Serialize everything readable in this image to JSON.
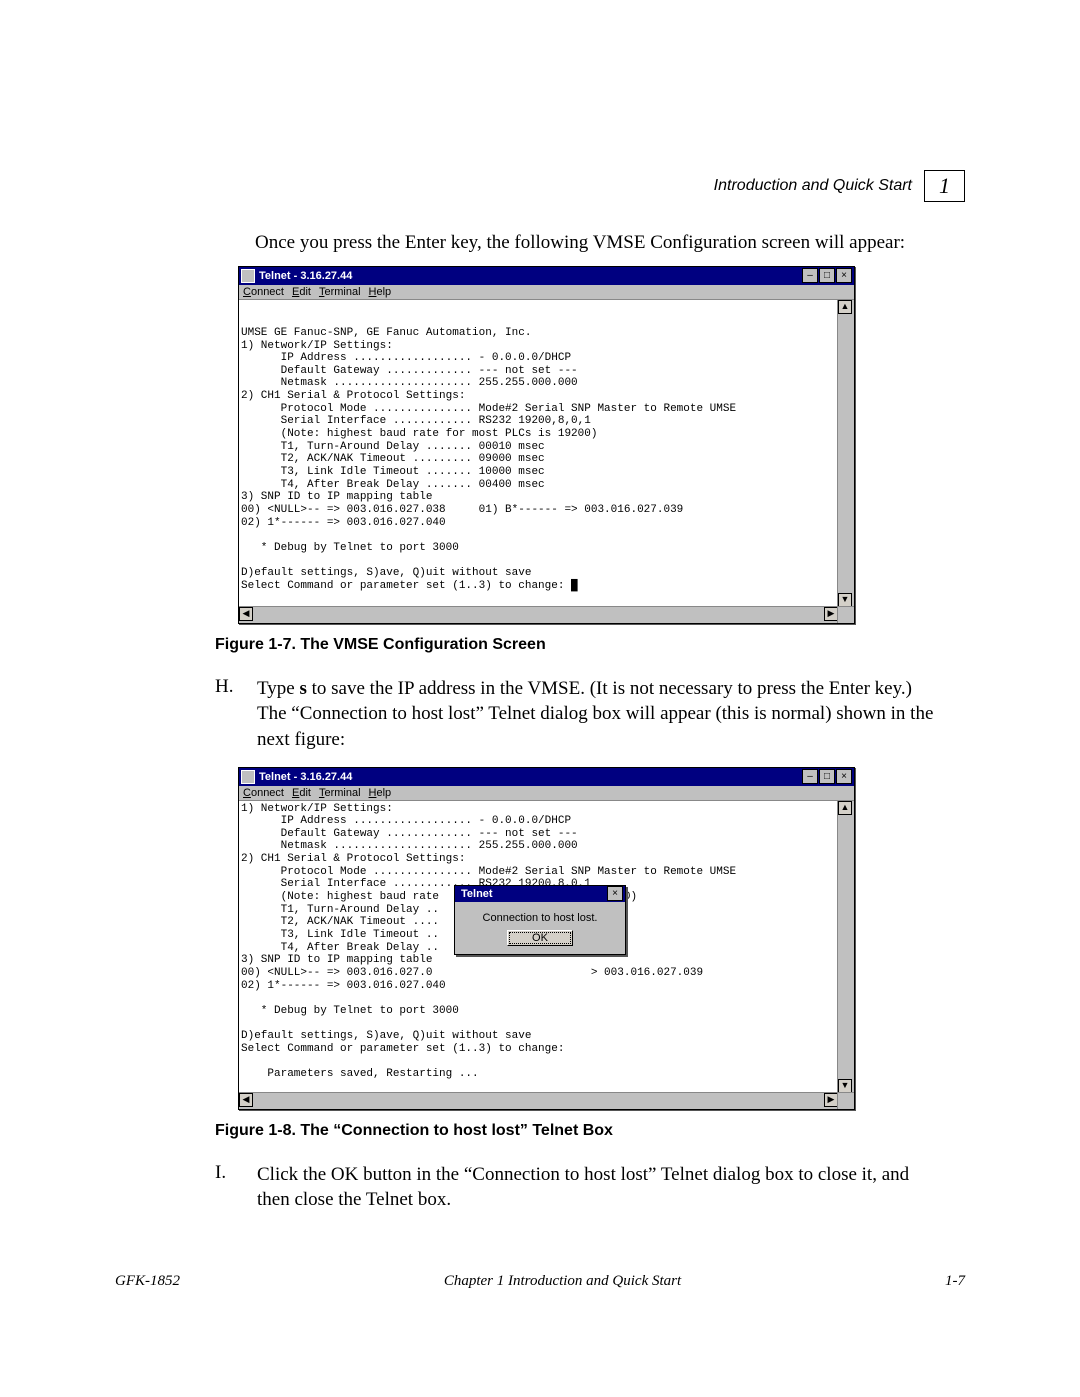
{
  "header": {
    "section_title": "Introduction and Quick Start",
    "chapter_number": "1"
  },
  "intro_para": "Once you press the Enter key, the following VMSE Configuration screen will appear:",
  "telnet1": {
    "title": "Telnet - 3.16.27.44",
    "menus": {
      "connect": "Connect",
      "edit": "Edit",
      "terminal": "Terminal",
      "help": "Help"
    },
    "content": "\n\nUMSE GE Fanuc-SNP, GE Fanuc Automation, Inc.\n1) Network/IP Settings:\n      IP Address .................. - 0.0.0.0/DHCP\n      Default Gateway ............. --- not set ---\n      Netmask ..................... 255.255.000.000\n2) CH1 Serial & Protocol Settings:\n      Protocol Mode ............... Mode#2 Serial SNP Master to Remote UMSE\n      Serial Interface ............ RS232 19200,8,0,1\n      (Note: highest baud rate for most PLCs is 19200)\n      T1, Turn-Around Delay ....... 00010 msec\n      T2, ACK/NAK Timeout ......... 09000 msec\n      T3, Link Idle Timeout ....... 10000 msec\n      T4, After Break Delay ....... 00400 msec\n3) SNP ID to IP mapping table\n00) <NULL>-- => 003.016.027.038     01) B*------ => 003.016.027.039\n02) 1*------ => 003.016.027.040\n\n   * Debug by Telnet to port 3000\n\nD)efault settings, S)ave, Q)uit without save\nSelect Command or parameter set (1..3) to change: █"
  },
  "fig1_caption": "Figure 1-7.  The VMSE Configuration Screen",
  "step_h": {
    "marker": "H.",
    "text_parts": {
      "p1": "Type ",
      "bold": "s",
      "p2": " to save the IP address in the VMSE.  (It is not necessary to press the Enter key.)  The “Connection to host lost” Telnet dialog box will appear (this is normal) shown in the next figure:"
    }
  },
  "telnet2": {
    "title": "Telnet - 3.16.27.44",
    "menus": {
      "connect": "Connect",
      "edit": "Edit",
      "terminal": "Terminal",
      "help": "Help"
    },
    "content": "1) Network/IP Settings:\n      IP Address .................. - 0.0.0.0/DHCP\n      Default Gateway ............. --- not set ---\n      Netmask ..................... 255.255.000.000\n2) CH1 Serial & Protocol Settings:\n      Protocol Mode ............... Mode#2 Serial SNP Master to Remote UMSE\n      Serial Interface ............ RS232 19200,8,0,1\n      (Note: highest baud rate                           00)\n      T1, Turn-Around Delay ..\n      T2, ACK/NAK Timeout ....\n      T3, Link Idle Timeout ..\n      T4, After Break Delay ..\n3) SNP ID to IP mapping table\n00) <NULL>-- => 003.016.027.0                        > 003.016.027.039\n02) 1*------ => 003.016.027.040\n\n   * Debug by Telnet to port 3000\n\nD)efault settings, S)ave, Q)uit without save\nSelect Command or parameter set (1..3) to change:\n\n    Parameters saved, Restarting ...\n",
    "dialog": {
      "title": "Telnet",
      "message": "Connection to host lost.",
      "ok": "OK"
    }
  },
  "fig2_caption": "Figure 1-8.  The “Connection to host lost” Telnet Box",
  "step_i": {
    "marker": "I.",
    "text": "Click the OK button in the “Connection to host lost” Telnet dialog box to close it, and then close the Telnet box."
  },
  "footer": {
    "left": "GFK-1852",
    "center": "Chapter 1  Introduction and Quick Start",
    "right": "1-7"
  },
  "glyphs": {
    "min": "–",
    "max": "□",
    "close": "×",
    "up": "▲",
    "down": "▼",
    "left": "◀",
    "right": "▶"
  }
}
